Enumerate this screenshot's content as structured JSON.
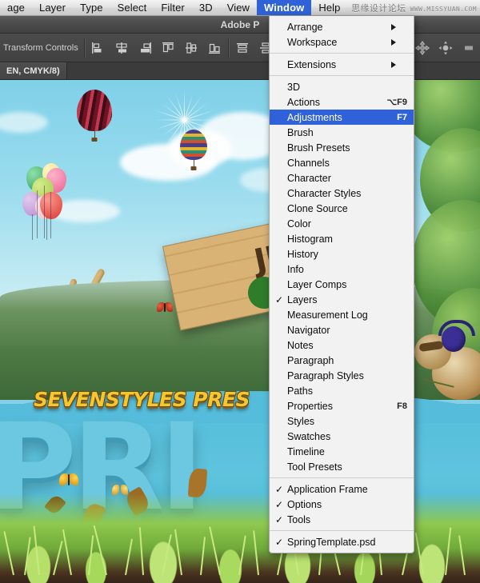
{
  "menubar": {
    "items": [
      {
        "label": "age",
        "active": false
      },
      {
        "label": "Layer",
        "active": false
      },
      {
        "label": "Type",
        "active": false
      },
      {
        "label": "Select",
        "active": false
      },
      {
        "label": "Filter",
        "active": false
      },
      {
        "label": "3D",
        "active": false
      },
      {
        "label": "View",
        "active": false
      },
      {
        "label": "Window",
        "active": true
      },
      {
        "label": "Help",
        "active": false
      }
    ]
  },
  "watermark": {
    "chinese": "思缘设计论坛",
    "url": "WWW.MISSYUAN.COM"
  },
  "titlebar": {
    "title": "Adobe P"
  },
  "optionsbar": {
    "transform_label": "Transform Controls",
    "align_icons": [
      "align-left-edges-icon",
      "align-horizontal-centers-icon",
      "align-right-edges-icon",
      "align-top-edges-icon",
      "align-vertical-centers-icon",
      "align-bottom-edges-icon"
    ],
    "distribute_icons": [
      "distribute-top-edges-icon",
      "distribute-vertical-centers-icon",
      "distribute-bottom-edges-icon"
    ],
    "threed_icons": [
      "3d-orbit-icon",
      "3d-pan-icon",
      "3d-slide-icon",
      "3d-scale-icon"
    ]
  },
  "tabbar": {
    "document_tab": "EN, CMYK/8)"
  },
  "canvas": {
    "headline": "SEVENSTYLES PRES",
    "bigword": "PRI",
    "sign_text": "JU"
  },
  "dropdown": {
    "groups": [
      {
        "items": [
          {
            "label": "Arrange",
            "submenu": true,
            "checked": false,
            "shortcut": ""
          },
          {
            "label": "Workspace",
            "submenu": true,
            "checked": false,
            "shortcut": ""
          }
        ]
      },
      {
        "items": [
          {
            "label": "Extensions",
            "submenu": true,
            "checked": false,
            "shortcut": ""
          }
        ]
      },
      {
        "items": [
          {
            "label": "3D",
            "submenu": false,
            "checked": false,
            "shortcut": ""
          },
          {
            "label": "Actions",
            "submenu": false,
            "checked": false,
            "shortcut": "⌥F9"
          },
          {
            "label": "Adjustments",
            "submenu": false,
            "checked": false,
            "shortcut": "F7",
            "selected": true
          },
          {
            "label": "Brush",
            "submenu": false,
            "checked": false,
            "shortcut": ""
          },
          {
            "label": "Brush Presets",
            "submenu": false,
            "checked": false,
            "shortcut": ""
          },
          {
            "label": "Channels",
            "submenu": false,
            "checked": false,
            "shortcut": ""
          },
          {
            "label": "Character",
            "submenu": false,
            "checked": false,
            "shortcut": ""
          },
          {
            "label": "Character Styles",
            "submenu": false,
            "checked": false,
            "shortcut": ""
          },
          {
            "label": "Clone Source",
            "submenu": false,
            "checked": false,
            "shortcut": ""
          },
          {
            "label": "Color",
            "submenu": false,
            "checked": false,
            "shortcut": ""
          },
          {
            "label": "Histogram",
            "submenu": false,
            "checked": false,
            "shortcut": ""
          },
          {
            "label": "History",
            "submenu": false,
            "checked": false,
            "shortcut": ""
          },
          {
            "label": "Info",
            "submenu": false,
            "checked": false,
            "shortcut": ""
          },
          {
            "label": "Layer Comps",
            "submenu": false,
            "checked": false,
            "shortcut": ""
          },
          {
            "label": "Layers",
            "submenu": false,
            "checked": true,
            "shortcut": ""
          },
          {
            "label": "Measurement Log",
            "submenu": false,
            "checked": false,
            "shortcut": ""
          },
          {
            "label": "Navigator",
            "submenu": false,
            "checked": false,
            "shortcut": ""
          },
          {
            "label": "Notes",
            "submenu": false,
            "checked": false,
            "shortcut": ""
          },
          {
            "label": "Paragraph",
            "submenu": false,
            "checked": false,
            "shortcut": ""
          },
          {
            "label": "Paragraph Styles",
            "submenu": false,
            "checked": false,
            "shortcut": ""
          },
          {
            "label": "Paths",
            "submenu": false,
            "checked": false,
            "shortcut": ""
          },
          {
            "label": "Properties",
            "submenu": false,
            "checked": false,
            "shortcut": "F8"
          },
          {
            "label": "Styles",
            "submenu": false,
            "checked": false,
            "shortcut": ""
          },
          {
            "label": "Swatches",
            "submenu": false,
            "checked": false,
            "shortcut": ""
          },
          {
            "label": "Timeline",
            "submenu": false,
            "checked": false,
            "shortcut": ""
          },
          {
            "label": "Tool Presets",
            "submenu": false,
            "checked": false,
            "shortcut": ""
          }
        ]
      },
      {
        "items": [
          {
            "label": "Application Frame",
            "submenu": false,
            "checked": true,
            "shortcut": ""
          },
          {
            "label": "Options",
            "submenu": false,
            "checked": true,
            "shortcut": ""
          },
          {
            "label": "Tools",
            "submenu": false,
            "checked": true,
            "shortcut": ""
          }
        ]
      },
      {
        "items": [
          {
            "label": "SpringTemplate.psd",
            "submenu": false,
            "checked": true,
            "shortcut": ""
          }
        ]
      }
    ]
  },
  "colors": {
    "menu_highlight": "#2f62d8",
    "menubar_bg": "#e2e2e2",
    "dropdown_bg": "#f2f2f2",
    "panel_bg": "#414141",
    "headline_yellow": "#f4c630",
    "bigword_blue": "#6cc8e0"
  }
}
